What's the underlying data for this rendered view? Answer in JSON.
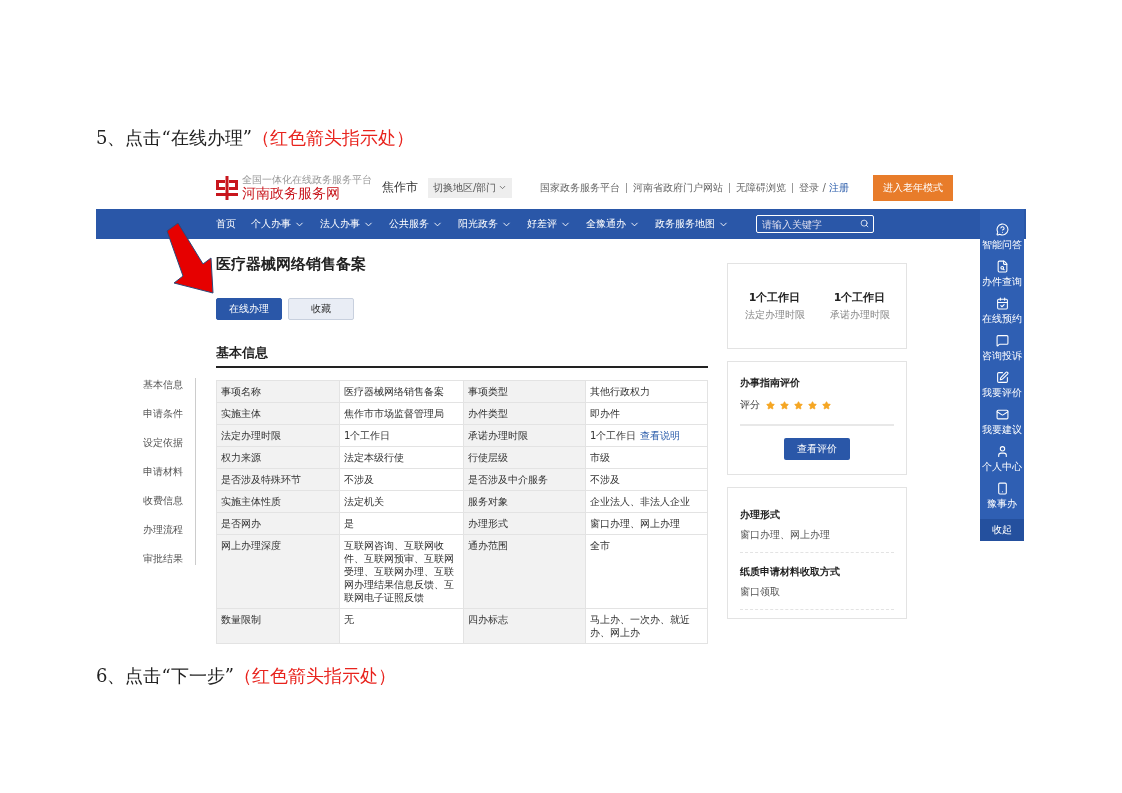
{
  "step_top": {
    "lead": "5、点击“在线办理”",
    "note": "（红色箭头指示处）"
  },
  "screenshot": {
    "header": {
      "tagline": "全国一体化在线政务服务平台",
      "site_name": "河南政务服务网",
      "city": "焦作市",
      "switcher": "切换地区/部门",
      "links": [
        "国家政务服务平台",
        "河南省政府门户网站",
        "无障碍浏览"
      ],
      "login": "登录",
      "slash": "/",
      "register": "注册",
      "elder_button": "进入老年模式"
    },
    "nav": {
      "items": [
        {
          "label": "首页",
          "dropdown": false
        },
        {
          "label": "个人办事",
          "dropdown": true
        },
        {
          "label": "法人办事",
          "dropdown": true
        },
        {
          "label": "公共服务",
          "dropdown": true
        },
        {
          "label": "阳光政务",
          "dropdown": true
        },
        {
          "label": "好差评",
          "dropdown": true
        },
        {
          "label": "全豫通办",
          "dropdown": true
        },
        {
          "label": "政务服务地图",
          "dropdown": true
        }
      ],
      "search_placeholder": "请输入关键字"
    },
    "title": "医疗器械网络销售备案",
    "buttons": [
      {
        "label": "在线办理",
        "kind": "primary"
      },
      {
        "label": "收藏",
        "kind": "secondary"
      }
    ],
    "section_title": "基本信息",
    "anchors": [
      "基本信息",
      "申请条件",
      "设定依据",
      "申请材料",
      "收费信息",
      "办理流程",
      "审批结果"
    ],
    "table": {
      "rows": [
        [
          {
            "text": "事项名称"
          },
          {
            "text": "医疗器械网络销售备案"
          },
          {
            "text": "事项类型"
          },
          {
            "text": "其他行政权力"
          }
        ],
        [
          {
            "text": "实施主体"
          },
          {
            "text": "焦作市市场监督管理局"
          },
          {
            "text": "办件类型"
          },
          {
            "text": "即办件"
          }
        ],
        [
          {
            "text": "法定办理时限"
          },
          {
            "text": "1个工作日"
          },
          {
            "text": "承诺办理时限"
          },
          {
            "text": "1个工作日",
            "link": "查看说明"
          }
        ],
        [
          {
            "text": "权力来源"
          },
          {
            "text": "法定本级行使"
          },
          {
            "text": "行使层级"
          },
          {
            "text": "市级"
          }
        ],
        [
          {
            "text": "是否涉及特殊环节"
          },
          {
            "text": "不涉及"
          },
          {
            "text": "是否涉及中介服务"
          },
          {
            "text": "不涉及"
          }
        ],
        [
          {
            "text": "实施主体性质"
          },
          {
            "text": "法定机关"
          },
          {
            "text": "服务对象"
          },
          {
            "text": "企业法人、非法人企业"
          }
        ],
        [
          {
            "text": "是否网办"
          },
          {
            "text": "是"
          },
          {
            "text": "办理形式"
          },
          {
            "text": "窗口办理、网上办理"
          }
        ],
        [
          {
            "text": "网上办理深度"
          },
          {
            "text": "互联网咨询、互联网收件、互联网预审、互联网受理、互联网办理、互联网办理结果信息反馈、互联网电子证照反馈"
          },
          {
            "text": "通办范围"
          },
          {
            "text": "全市"
          }
        ],
        [
          {
            "text": "数量限制"
          },
          {
            "text": "无"
          },
          {
            "text": "四办标志"
          },
          {
            "text": "马上办、一次办、就近办、网上办"
          }
        ]
      ]
    },
    "time_card": [
      {
        "value": "1个工作日",
        "label": "法定办理时限"
      },
      {
        "value": "1个工作日",
        "label": "承诺办理时限"
      }
    ],
    "rating_card": {
      "title": "办事指南评价",
      "label": "评分",
      "stars": 5,
      "button": "查看评价"
    },
    "info_card": [
      {
        "title": "办理形式",
        "value": "窗口办理、网上办理"
      },
      {
        "title": "纸质申请材料收取方式",
        "value": "窗口领取"
      }
    ],
    "float_bar": {
      "items": [
        "智能问答",
        "办件查询",
        "在线预约",
        "咨询投诉",
        "我要评价",
        "我要建议",
        "个人中心",
        "豫事办"
      ],
      "collapse": "收起"
    }
  },
  "step_bottom": {
    "lead": "6、点击“下一步”",
    "note": "（红色箭头指示处）"
  }
}
